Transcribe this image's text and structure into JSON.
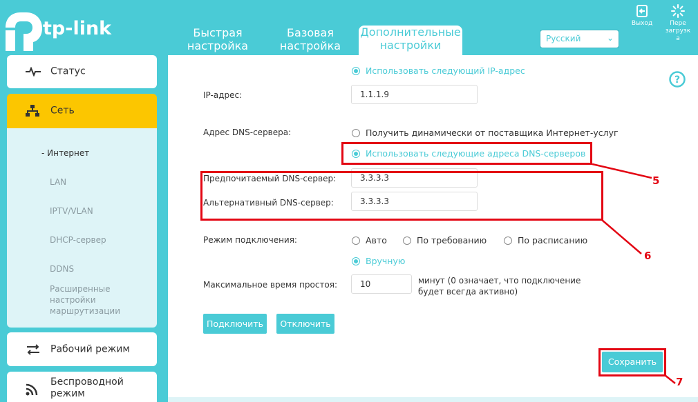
{
  "header": {
    "logo_text": "tp-link",
    "tabs": [
      {
        "label": "Быстрая настройка"
      },
      {
        "label": "Базовая настройка"
      },
      {
        "label": "Дополнительные настройки"
      }
    ],
    "language": "Русский",
    "logout_label": "Выход",
    "reboot_label": "Пере загрузк а"
  },
  "sidebar": {
    "status": "Статус",
    "network": "Сеть",
    "submenu": [
      "Интернет",
      "LAN",
      "IPTV/VLAN",
      "DHCP-сервер",
      "DDNS",
      "Расширенные настройки маршрутизации"
    ],
    "work_mode": "Рабочий режим",
    "wireless": "Беспроводной режим"
  },
  "form": {
    "use_ip_option": "Использовать следующий IP-адрес",
    "ip_label": "IP-адрес:",
    "ip_value": "1.1.1.9",
    "dns_label": "Адрес DNS-сервера:",
    "dns_dynamic_option": "Получить динамически от поставщика Интернет-услуг",
    "dns_static_option": "Использовать следующие адреса DNS-серверов",
    "preferred_dns_label": "Предпочитаемый DNS-сервер:",
    "preferred_dns_value": "3.3.3.3",
    "alt_dns_label": "Альтернативный DNS-сервер:",
    "alt_dns_value": "3.3.3.3",
    "mode_label": "Режим подключения:",
    "mode_options": [
      "Авто",
      "По требованию",
      "По расписанию",
      "Вручную"
    ],
    "idle_label": "Максимальное время простоя:",
    "idle_value": "10",
    "idle_hint": "минут (0 означает, что подключение будет всегда активно)",
    "connect_button": "Подключить",
    "disconnect_button": "Отключить",
    "save_button": "Сохранить"
  },
  "annotations": [
    "5",
    "6",
    "7"
  ],
  "colors": {
    "accent": "#4acbd6",
    "active_menu": "#fcc600",
    "annotation": "#e30613"
  }
}
